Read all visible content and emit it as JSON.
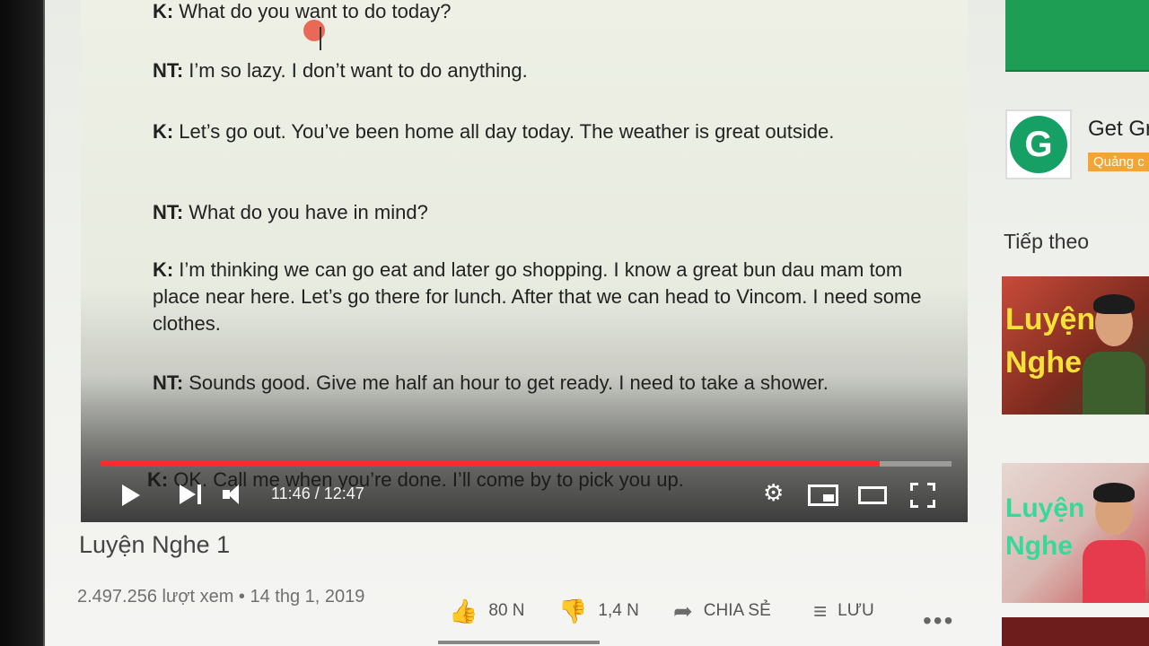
{
  "transcript": [
    {
      "speaker": "K:",
      "text": "What do you want to do today?"
    },
    {
      "speaker": "NT:",
      "text": "I’m so lazy. I don’t want to do anything."
    },
    {
      "speaker": "K:",
      "text": "Let’s go out. You’ve been home all day today. The weather is great outside."
    },
    {
      "speaker": "NT:",
      "text": "What do you have in mind?"
    },
    {
      "speaker": "K:",
      "text": "I’m thinking we can go eat and later go shopping. I know a great bun dau mam tom place near here. Let’s go there for lunch. After that we can head to Vincom. I need some clothes."
    },
    {
      "speaker": "NT:",
      "text": "Sounds good. Give me half an hour to get ready. I need to take a shower."
    },
    {
      "speaker": "K:",
      "text": "OK. Call me when you’re done. I’ll come by to pick you up."
    }
  ],
  "player": {
    "time_display": "11:46 / 12:47",
    "progress_fraction": 0.916,
    "progress_color": "#ff2a2a"
  },
  "video": {
    "title": "Luyện Nghe 1",
    "stats": "2.497.256 lượt xem • 14 thg 1, 2019",
    "likes": "80 N",
    "dislikes": "1,4 N",
    "share_label": "CHIA SẺ",
    "save_label": "LƯU",
    "more": "•••"
  },
  "ad": {
    "title": "Get Gr",
    "badge": "Quảng c",
    "logo_letter": "G"
  },
  "sidebar": {
    "next_label": "Tiếp theo",
    "thumbs": [
      {
        "line1": "Luyện",
        "line2": "Nghe"
      },
      {
        "line1": "Luyện",
        "line2": "Nghe"
      }
    ]
  },
  "icons": {
    "play": "play-icon",
    "next": "next-icon",
    "volume": "volume-icon",
    "settings": "gear-icon",
    "miniplayer": "miniplayer-icon",
    "theater": "theater-icon",
    "fullscreen": "fullscreen-icon",
    "like": "thumbs-up-icon",
    "dislike": "thumbs-down-icon",
    "share": "share-icon",
    "save": "playlist-add-icon"
  }
}
